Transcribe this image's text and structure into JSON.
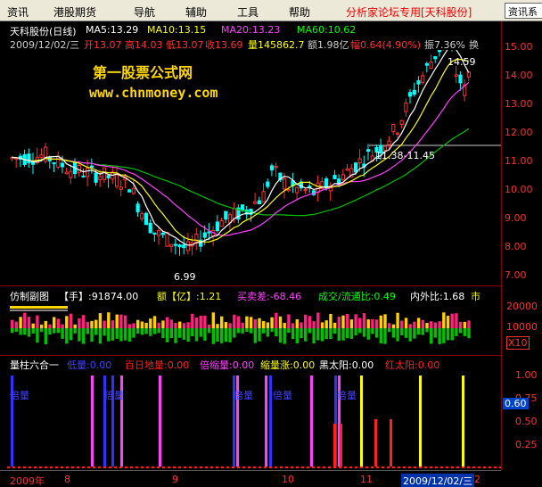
{
  "menu": {
    "items": [
      "资讯",
      "港股期货",
      "导航",
      "辅助",
      "工具",
      "帮助"
    ],
    "promo": "分析家论坛专用[天科股份]",
    "right_button": "资讯系"
  },
  "main_chart": {
    "stock_name": "天科股份(日线)",
    "ma": [
      {
        "label": "MA5:13.29",
        "color": "#ffffff"
      },
      {
        "label": "MA10:13.15",
        "color": "#ffff00"
      },
      {
        "label": "MA20:13.23",
        "color": "#ff40ff"
      },
      {
        "label": "MA60:10.62",
        "color": "#00ff00"
      }
    ],
    "info_date": "2009/12/02/三",
    "info_open": "开13.07",
    "info_high": "高14.03",
    "info_low": "低13.07",
    "info_close": "收13.69",
    "info_vol": "量145862.7",
    "info_amt": "额1.98亿",
    "info_change": "幅0.64(4.90%)",
    "info_amp": "振7.36%",
    "info_turn": "换",
    "watermark_title": "第一股票公式网",
    "watermark_url": "www.chnmoney.com",
    "annot_high": "14.59",
    "annot_range": "11.38-11.45",
    "annot_low": "6.99",
    "price_ticks": [
      "15.00",
      "14.00",
      "13.00",
      "12.00",
      "11.00",
      "10.00",
      "9.00",
      "8.00",
      "7.00"
    ]
  },
  "volume_panel": {
    "label": "仿制副图",
    "hand": "【手】:91874.00",
    "amount": "额【亿】:1.21",
    "buysell": "买卖差:-68.46",
    "circ": "成交/流通比:0.49",
    "inout": "内外比:1.68",
    "market": "市",
    "tick_top": "20000",
    "tick_mid": "10000",
    "multiplier": "X10"
  },
  "indicator_panel": {
    "name": "量柱六合一",
    "items": [
      {
        "label": "低量:0.00",
        "color": "#4040ff"
      },
      {
        "label": "百日地量:0.00",
        "color": "#ff2020"
      },
      {
        "label": "倍缩量:0.00",
        "color": "#ff40ff"
      },
      {
        "label": "缩量涨:0.00",
        "color": "#ffff00"
      },
      {
        "label": "黑太阳:0.00",
        "color": "#ffffff"
      },
      {
        "label": "红太阳:0.00",
        "color": "#ff2020"
      }
    ],
    "bei_label": "倍量",
    "ticks": [
      "1.00",
      "0.75",
      "0.50",
      "0.25"
    ],
    "current_value": "0.60"
  },
  "date_axis": {
    "labels": [
      "2009年",
      "8",
      "9",
      "10",
      "11",
      "2"
    ],
    "cursor_date": "2009/12/02/三"
  }
}
